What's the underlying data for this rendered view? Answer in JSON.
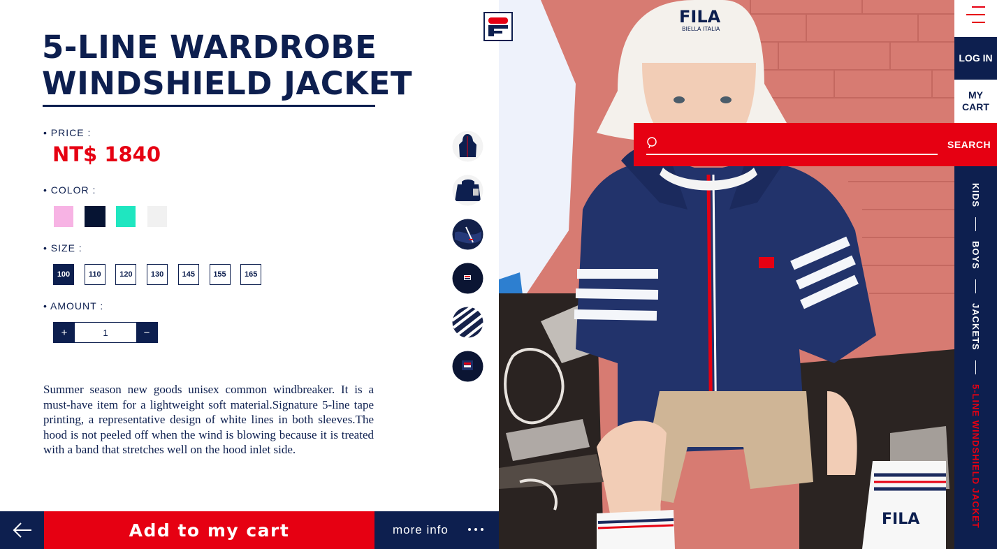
{
  "product": {
    "title_line1": "5-LINE WARDROBE",
    "title_line2": "WINDSHIELD JACKET",
    "price_label": "• PRICE :",
    "price": "NT$ 1840",
    "color_label": "• COLOR :",
    "colors": [
      "#f7b3e4",
      "#061433",
      "#1fe6c0",
      "#f1f1f1"
    ],
    "size_label": "• SIZE :",
    "sizes": [
      "100",
      "110",
      "120",
      "130",
      "145",
      "155",
      "165"
    ],
    "selected_size": "100",
    "amount_label": "• AMOUNT :",
    "amount": "1",
    "plus": "+",
    "minus": "−",
    "description": "Summer season new goods unisex common windbreaker. It is a must-have item for a lightweight soft material.Signature 5-line tape printing, a representative design of white lines in both sleeves.The hood is not peeled off when the wind is blowing because it is treated with a band that stretches well on the hood inlet side."
  },
  "actions": {
    "add_to_cart": "Add to my cart",
    "more_info": "more info"
  },
  "nav": {
    "login": "LOG IN",
    "mycart": "MY CART",
    "search_label": "SEARCH",
    "search_placeholder": "",
    "breadcrumbs": [
      "KIDS",
      "BOYS",
      "JACKETS",
      "5-LINE WINDSHIELD JACKET"
    ]
  },
  "photo": {
    "hat_logo": "FILA",
    "hat_sub": "BIELLA ITALIA",
    "sock_logo": "FILA"
  },
  "colors": {
    "navy": "#0d1f4f",
    "red": "#e60012"
  }
}
